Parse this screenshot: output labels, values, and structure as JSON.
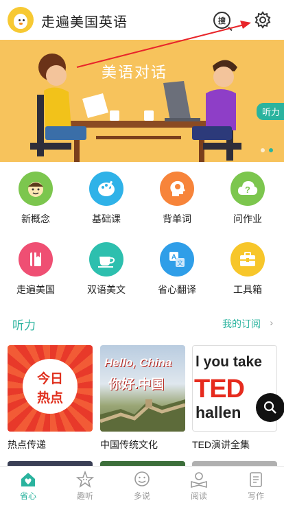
{
  "header": {
    "title": "走遍美国英语",
    "search_label": "搜"
  },
  "banner": {
    "caption": "美语对话",
    "tag": "听力"
  },
  "features": [
    {
      "label": "新概念",
      "icon": "face-icon",
      "color": "#7cc64e"
    },
    {
      "label": "基础课",
      "icon": "palette-icon",
      "color": "#2fb2e8"
    },
    {
      "label": "背单词",
      "icon": "head-icon",
      "color": "#f7843a"
    },
    {
      "label": "问作业",
      "icon": "question-cloud-icon",
      "color": "#7cc64e"
    },
    {
      "label": "走遍美国",
      "icon": "book-icon",
      "color": "#ef4f73"
    },
    {
      "label": "双语美文",
      "icon": "cup-icon",
      "color": "#2dbfae"
    },
    {
      "label": "省心翻译",
      "icon": "translate-icon",
      "color": "#2f9ee8"
    },
    {
      "label": "工具箱",
      "icon": "toolbox-icon",
      "color": "#f7c62a"
    }
  ],
  "section": {
    "title": "听力",
    "more": "我的订阅",
    "chevron": "›"
  },
  "cards": [
    {
      "caption": "热点传递",
      "art_line1": "今日",
      "art_line2": "热点"
    },
    {
      "caption": "中国传统文化",
      "art_line1": "Hello, China",
      "art_line2": "你好.中国"
    },
    {
      "caption": "TED演讲全集",
      "art_line1": "l you take",
      "art_line2": "TED",
      "art_line3": "hallen"
    }
  ],
  "tabs": [
    {
      "label": "省心",
      "icon": "home-heart-icon",
      "active": true
    },
    {
      "label": "趣听",
      "icon": "star-face-icon",
      "active": false
    },
    {
      "label": "多说",
      "icon": "chat-face-icon",
      "active": false
    },
    {
      "label": "阅读",
      "icon": "reader-icon",
      "active": false
    },
    {
      "label": "写作",
      "icon": "document-icon",
      "active": false
    }
  ],
  "colors": {
    "accent": "#2ab39e",
    "banner_bg": "#f7c35c",
    "annotation_arrow": "#e8252a"
  }
}
